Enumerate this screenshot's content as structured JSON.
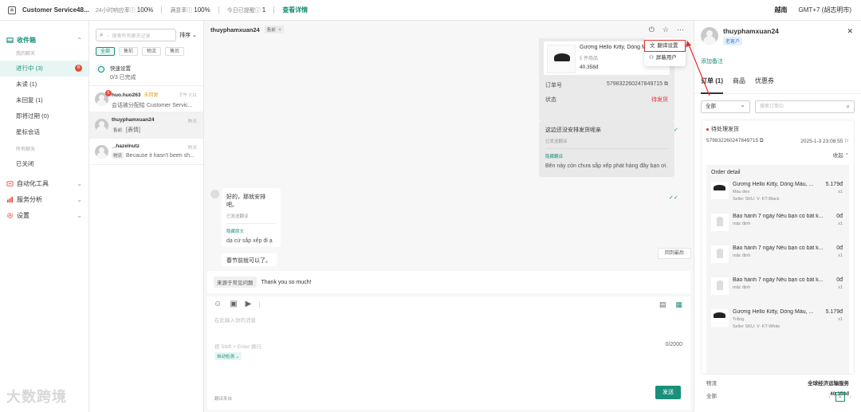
{
  "brand": {
    "title": "Customer Service48..."
  },
  "top_stats": [
    {
      "label": "24小时响应率",
      "value": "100%"
    },
    {
      "label": "满意率",
      "value": "100%"
    },
    {
      "label": "今日已提醒",
      "value": "1"
    }
  ],
  "top_link": "查看详情",
  "top_right": {
    "language": "越南",
    "timezone": "GMT+7 (胡志明市)"
  },
  "nav": {
    "inbox": "收件箱",
    "my_chats": "我的聊天",
    "items": [
      {
        "label": "进行中 (3)",
        "badge": "6"
      },
      {
        "label": "未读 (1)"
      },
      {
        "label": "未回复 (1)"
      },
      {
        "label": "即将过期 (0)"
      },
      {
        "label": "星标会话"
      }
    ],
    "all_chats": "所有聊天",
    "closed": "已关闭",
    "automation": "自动化工具",
    "analytics": "服务分析",
    "settings": "设置"
  },
  "clist": {
    "search_placeholder": "搜索所有聊天记录",
    "sort": "排序",
    "filters": [
      "全部",
      "售前",
      "物流",
      "售后"
    ],
    "quick_setup": {
      "title": "快速设置",
      "progress": "0/3 已完成"
    },
    "conversations": [
      {
        "name": "huo.huo263",
        "tag": "未回复",
        "time": "下午 2:11",
        "preview": "会话被分配给 Customer Servic...",
        "badge": "6"
      },
      {
        "name": "thuyphamxuan24",
        "tag": "",
        "time": "昨天",
        "mini_tag": "售前",
        "preview": "[表情]"
      },
      {
        "name": "_.hazelnutz",
        "tag": "",
        "time": "昨天",
        "mini_tag": "物流",
        "preview": "Because it hasn't been sh..."
      }
    ]
  },
  "chat": {
    "name": "thuyphamxuan24",
    "tag": "售前",
    "menu": [
      "翻译设置",
      "屏蔽用户"
    ],
    "product": {
      "name": "Gương Hello Kitty, Dòng M...",
      "qty": "5 件商品",
      "price": "40.358đ"
    },
    "order_label": "订单号",
    "order_id": "579832260247849715",
    "status_label": "状态",
    "status_value": "待发货",
    "out_msg": {
      "text": "这边还没安排发货呢亲",
      "sub": "已发送翻译",
      "hide": "隐藏翻译",
      "translated": "Bên này còn chưa sắp xếp phát hàng đây bạn ơi."
    },
    "in_msg1": {
      "text": "好的，那就安排吧。",
      "sub": "已发送翻译",
      "hide": "隐藏原文",
      "translated": "dạ cứ sắp xếp đi ạ"
    },
    "in_msg2": {
      "text": "春节前就可以了。"
    },
    "back_latest": "回到最后",
    "quick_reply_tag": "来源于常见问题",
    "quick_reply_text": "Thank you so much!",
    "placeholder": "在此输入你的消息",
    "hint": "按 Shift + Enter 换行",
    "counter": "0/2000",
    "auto_detect": "自动检测",
    "footer_note": "翻译来自",
    "send": "发送"
  },
  "rpanel": {
    "name": "thuyphamxuan24",
    "tag": "老客户",
    "add_note": "添加备注",
    "tabs": [
      "订单 (1)",
      "商品",
      "优惠券"
    ],
    "filter_select": "全部",
    "search_placeholder": "搜索订单ID",
    "order": {
      "status": "待处理发货",
      "id": "579832260247849715",
      "date": "2025-1-3 23:08:55",
      "fold": "收起",
      "detail_title": "Order detail",
      "items": [
        {
          "name": "Gương Hello Kitty, Dòng Màu, ...",
          "variant": "Màu đen",
          "sku": "Seller SKU: V- KT-Black",
          "price": "5.179đ",
          "qty": "x1",
          "img": "g"
        },
        {
          "name": "Bảo hành 7 ngày Nếu bạn có bất k...",
          "variant": "mặc định",
          "sku": "",
          "price": "0đ",
          "qty": "x1",
          "img": "p"
        },
        {
          "name": "Bảo hành 7 ngày Nếu bạn có bất k...",
          "variant": "mặc định",
          "sku": "",
          "price": "0đ",
          "qty": "x1",
          "img": "p"
        },
        {
          "name": "Bảo hành 7 ngày Nếu bạn có bất k...",
          "variant": "mặc định",
          "sku": "",
          "price": "0đ",
          "qty": "x1",
          "img": "p"
        },
        {
          "name": "Gương Hello Kitty, Dòng Màu, ...",
          "variant": "Trắng",
          "sku": "Seller SKU: V- KT-White",
          "price": "5.179đ",
          "qty": "x1",
          "img": "g"
        }
      ],
      "shipping_label": "物流",
      "shipping_value": "全球经济运输服务",
      "total_label": "全部",
      "total_value": "40.358đ"
    },
    "page": "1"
  },
  "watermark": "大数跨境",
  "colors": {
    "accent": "#1a8f7a",
    "alert": "#e32e2e"
  }
}
